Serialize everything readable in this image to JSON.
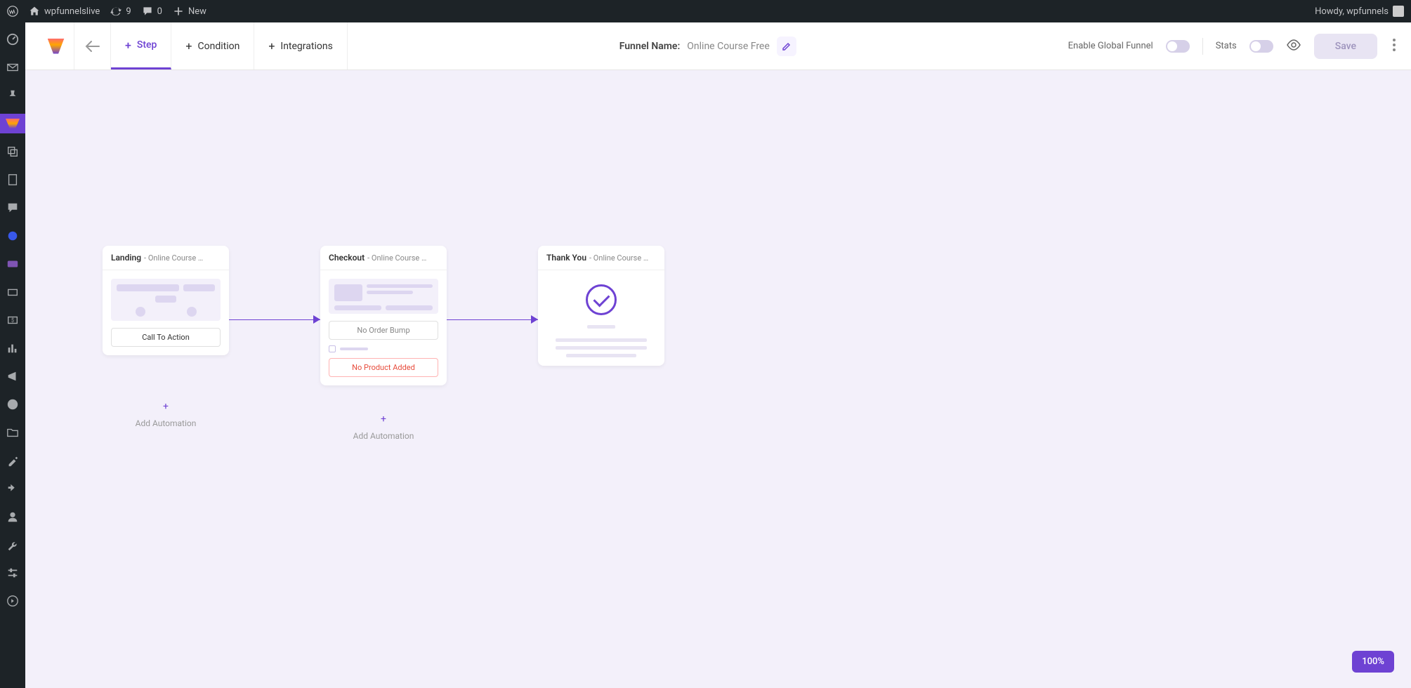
{
  "adminBar": {
    "siteName": "wpfunnelslive",
    "updates": "9",
    "comments": "0",
    "newLabel": "New",
    "greeting": "Howdy, wpfunnels"
  },
  "toolbar": {
    "tabs": {
      "step": "Step",
      "condition": "Condition",
      "integrations": "Integrations"
    },
    "funnelNameLabel": "Funnel Name:",
    "funnelNameValue": "Online Course Free",
    "enableGlobal": "Enable Global Funnel",
    "stats": "Stats",
    "save": "Save"
  },
  "nodes": {
    "landing": {
      "type": "Landing",
      "title": "- Online Course …",
      "cta": "Call To Action"
    },
    "checkout": {
      "type": "Checkout",
      "title": "- Online Course …",
      "orderbump": "No Order Bump",
      "noproduct": "No Product Added"
    },
    "thankyou": {
      "type": "Thank You",
      "title": "- Online Course …"
    }
  },
  "automation": {
    "add": "Add Automation"
  },
  "zoom": "100%"
}
